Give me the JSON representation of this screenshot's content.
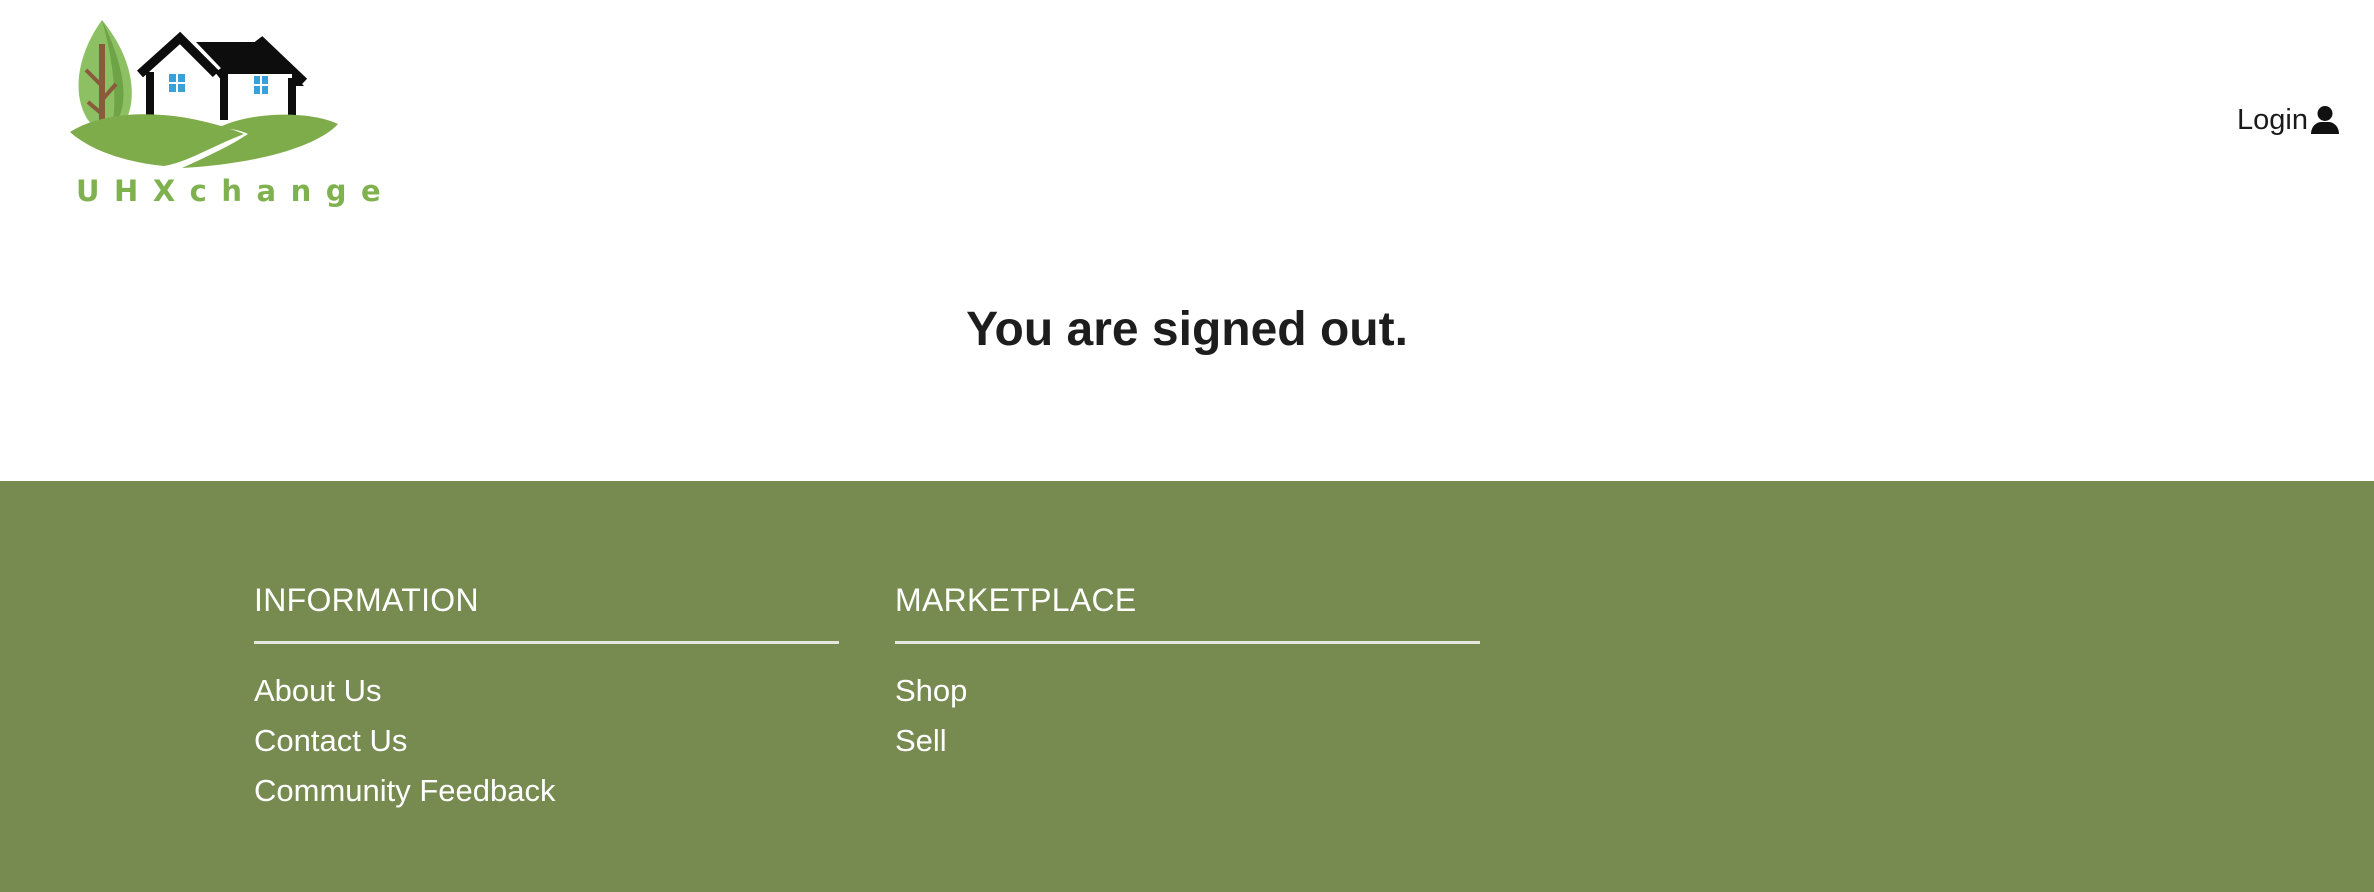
{
  "header": {
    "logo_text": "UHXchange",
    "login_label": "Login",
    "login_icon": "user-icon"
  },
  "main": {
    "message": "You are signed out."
  },
  "footer": {
    "information": {
      "heading": "INFORMATION",
      "links": [
        "About Us",
        "Contact Us",
        "Community Feedback"
      ]
    },
    "marketplace": {
      "heading": "MARKETPLACE",
      "links": [
        "Shop",
        "Sell"
      ]
    }
  },
  "colors": {
    "footer_bg": "#778b51",
    "logo_green": "#7fb24f",
    "text_dark": "#1d1d1d"
  }
}
